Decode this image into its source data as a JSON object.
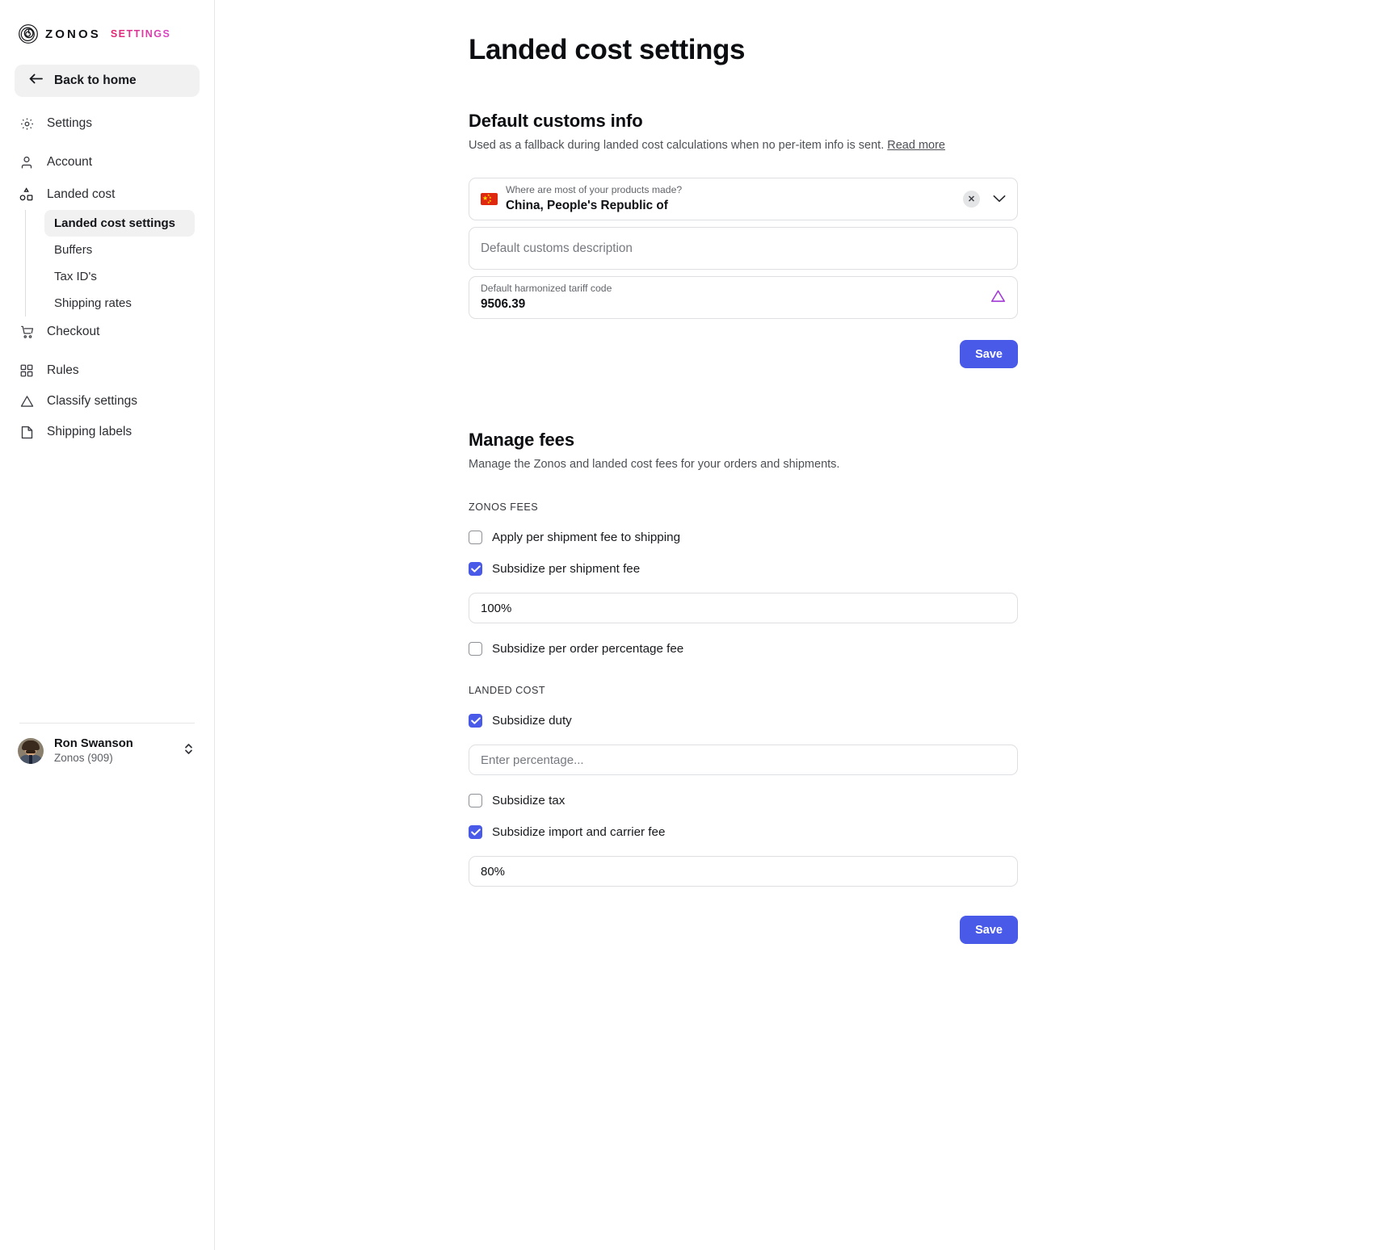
{
  "brand": {
    "word": "ZONOS",
    "sub": "SETTINGS",
    "logo_icon": "zonos-spiral-logo-icon"
  },
  "sidebar": {
    "back_home": {
      "label": "Back to home",
      "icon": "arrow-left-icon"
    },
    "items": [
      {
        "label": "Settings",
        "icon": "gear-icon"
      },
      {
        "label": "Account",
        "icon": "user-icon"
      },
      {
        "label": "Landed cost",
        "icon": "shapes-icon"
      },
      {
        "label": "Checkout",
        "icon": "cart-icon"
      },
      {
        "label": "Rules",
        "icon": "grid-icon"
      },
      {
        "label": "Classify settings",
        "icon": "triangle-icon"
      },
      {
        "label": "Shipping labels",
        "icon": "label-icon"
      }
    ],
    "sub_items": [
      {
        "label": "Landed cost settings",
        "active": true
      },
      {
        "label": "Buffers",
        "active": false
      },
      {
        "label": "Tax ID's",
        "active": false
      },
      {
        "label": "Shipping rates",
        "active": false
      }
    ],
    "user": {
      "name": "Ron Swanson",
      "org": "Zonos (909)",
      "avatar_icon": "avatar",
      "switch_icon": "chevron-up-down-icon"
    }
  },
  "page": {
    "title": "Landed cost settings"
  },
  "customs": {
    "heading": "Default customs info",
    "subtitle": "Used as a fallback during landed cost calculations when no per-item info is sent.",
    "read_more": "Read more",
    "country": {
      "label": "Where are most of your products made?",
      "value": "China, People's Republic of",
      "flag_icon": "flag-china-icon",
      "clear_icon": "clear-x-icon",
      "chevron_icon": "chevron-down-icon"
    },
    "description": {
      "placeholder": "Default customs description",
      "value": ""
    },
    "tariff": {
      "label": "Default harmonized tariff code",
      "value": "9506.39",
      "warn_icon": "warning-triangle-icon"
    },
    "save_label": "Save"
  },
  "fees": {
    "heading": "Manage fees",
    "subtitle": "Manage the Zonos and landed cost fees for your orders and shipments.",
    "zonos_group_label": "ZONOS FEES",
    "landed_group_label": "LANDED COST",
    "zonos_items": [
      {
        "label": "Apply per shipment fee to shipping",
        "checked": false
      },
      {
        "label": "Subsidize per shipment fee",
        "checked": true
      },
      {
        "label": "Subsidize per order percentage fee",
        "checked": false
      }
    ],
    "per_shipment_percent": {
      "value": "100%",
      "placeholder": "Enter percentage..."
    },
    "landed_items": [
      {
        "label": "Subsidize duty",
        "checked": true
      },
      {
        "label": "Subsidize tax",
        "checked": false
      },
      {
        "label": "Subsidize import and carrier fee",
        "checked": true
      }
    ],
    "duty_percent": {
      "value": "",
      "placeholder": "Enter percentage..."
    },
    "import_percent": {
      "value": "80%",
      "placeholder": "Enter percentage..."
    },
    "save_label": "Save"
  },
  "colors": {
    "accent_blue": "#4a5ae8",
    "brand_pink": "#e0256e",
    "brand_magenta": "#d946c8",
    "warn_purple": "#a23ad8",
    "active_bg": "#f1f1f2"
  }
}
